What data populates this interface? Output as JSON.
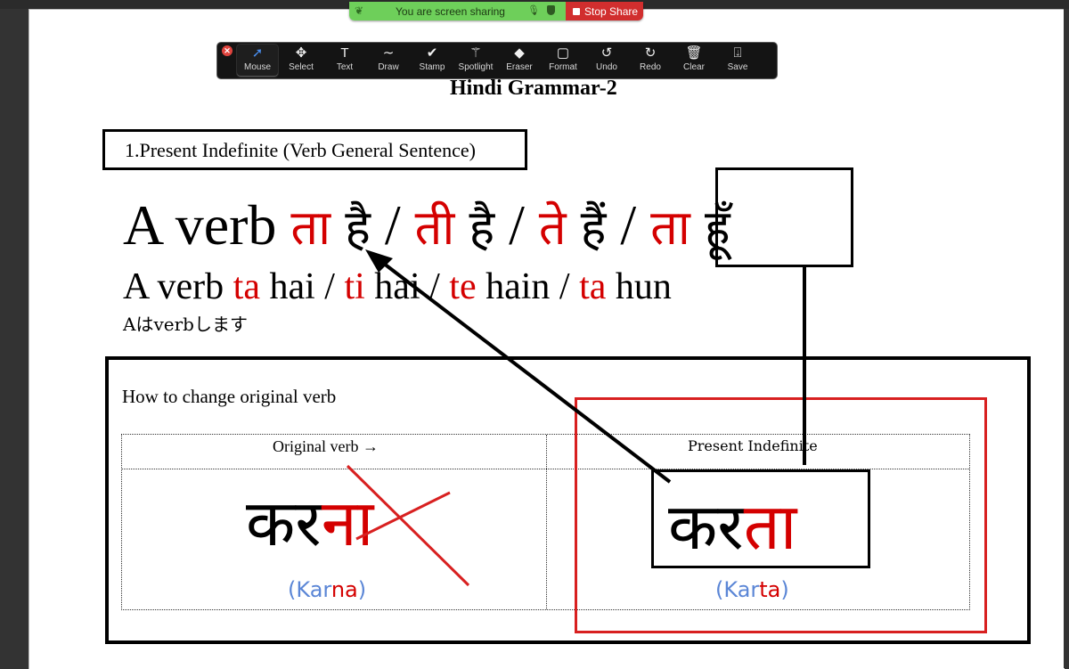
{
  "share_banner": {
    "status_text": "You are screen sharing",
    "stop_label": "Stop Share",
    "colors": {
      "green": "#6ecf5a",
      "red": "#d12e2e"
    }
  },
  "toolbar": {
    "close_icon": "close-icon",
    "tools": [
      {
        "label": "Mouse",
        "icon": "cursor-arrow-icon",
        "glyph": "➚",
        "active": true
      },
      {
        "label": "Select",
        "icon": "move-arrows-icon",
        "glyph": "✥",
        "active": false
      },
      {
        "label": "Text",
        "icon": "text-icon",
        "glyph": "T",
        "active": false
      },
      {
        "label": "Draw",
        "icon": "squiggle-icon",
        "glyph": "∼",
        "active": false
      },
      {
        "label": "Stamp",
        "icon": "checkmark-icon",
        "glyph": "✔",
        "active": false
      },
      {
        "label": "Spotlight",
        "icon": "magic-wand-icon",
        "glyph": "⚚",
        "active": false
      },
      {
        "label": "Eraser",
        "icon": "eraser-icon",
        "glyph": "◆",
        "active": false
      },
      {
        "label": "Format",
        "icon": "square-icon",
        "glyph": "▢",
        "active": false
      },
      {
        "label": "Undo",
        "icon": "undo-icon",
        "glyph": "↺",
        "active": false
      },
      {
        "label": "Redo",
        "icon": "redo-icon",
        "glyph": "↻",
        "active": false
      },
      {
        "label": "Clear",
        "icon": "trash-icon",
        "glyph": "🗑",
        "active": false
      },
      {
        "label": "Save",
        "icon": "save-tray-icon",
        "glyph": "⍗",
        "active": false
      }
    ]
  },
  "document": {
    "title": "Hindi Grammar-2",
    "section_heading": "1.Present Indefinite (Verb General Sentence)",
    "hindi_line": {
      "prefix": "A verb ",
      "parts": [
        {
          "suffix": "ता",
          "aux": "है"
        },
        {
          "suffix": "ती",
          "aux": "है"
        },
        {
          "suffix": "ते",
          "aux": "हैं"
        },
        {
          "suffix": "ता",
          "aux": "हूँ"
        }
      ],
      "separator": " / "
    },
    "roman_line": {
      "prefix": "A verb ",
      "parts": [
        {
          "suffix": "ta",
          "aux": "hai"
        },
        {
          "suffix": "ti",
          "aux": "hai"
        },
        {
          "suffix": "te",
          "aux": "hain"
        },
        {
          "suffix": "ta",
          "aux": "hun"
        }
      ],
      "separator": " / "
    },
    "japanese_line": "Aはverbします",
    "how_to_heading": "How to change original verb",
    "table": {
      "headers": [
        "Original verb →",
        "Present Indefinite"
      ],
      "original": {
        "stem": "कर",
        "ending": "ना",
        "translit_stem": "Kar",
        "translit_ending": "na"
      },
      "present": {
        "stem": "कर",
        "ending": "ता",
        "translit_stem": "Kar",
        "translit_ending": "ta"
      }
    },
    "colors": {
      "highlight_red": "#d40000",
      "translit_blue": "#5b86d6",
      "annotation_red": "#d82020"
    }
  }
}
